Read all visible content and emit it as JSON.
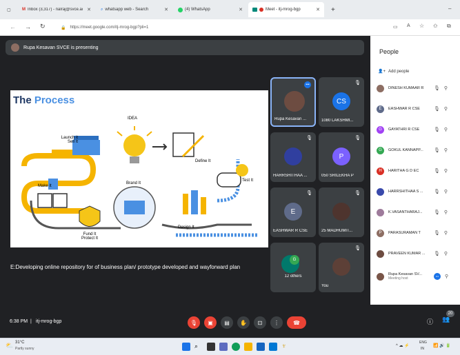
{
  "browser": {
    "tabs": [
      {
        "label": "Inbox (3,317) - nalraj@svce.ac.in",
        "icon": "gmail-icon"
      },
      {
        "label": "whatsapp web - Search",
        "icon": "search-icon"
      },
      {
        "label": "(4) WhatsApp",
        "icon": "whatsapp-icon"
      },
      {
        "label": "Meet - itj-mrog-bgp",
        "icon": "meet-icon"
      }
    ],
    "url": "https://meet.google.com/itj-mrog-bgp?pli=1"
  },
  "meet": {
    "presenting_banner": "Rupa Kesavan SVCE is presenting",
    "slide": {
      "title_part1": "The",
      "title_part2": "Process",
      "labels": [
        "IDEA",
        "Launch it\nSell It",
        "Define It",
        "Make It",
        "Brand It",
        "Test It",
        "Design It",
        "Fund It\nProtect It"
      ]
    },
    "caption": "E:Developing online repository for of business plan/ prototype developed and wayforward plan",
    "tiles": [
      {
        "name": "Rupa Kesavan ...",
        "initials": "",
        "color": "#5f6368"
      },
      {
        "name": "1080 LAKSHMI...",
        "initials": "CS",
        "color": "#1a73e8"
      },
      {
        "name": "HARRSHITHAA ...",
        "initials": "",
        "color": "#5f6368"
      },
      {
        "name": "050 SRILEKHA P",
        "initials": "P",
        "color": "#7b61ff"
      },
      {
        "name": "EASHWAR R CSE",
        "initials": "E",
        "color": "#5f6368"
      },
      {
        "name": "25 MADHUMIT...",
        "initials": "",
        "color": "#5f6368"
      },
      {
        "name": "12 others",
        "initials": "",
        "color": "#5f6368"
      },
      {
        "name": "You",
        "initials": "",
        "color": "#5f6368"
      }
    ],
    "time": "6:38 PM",
    "meeting_code": "itj-mrog-bgp",
    "participant_count": "20"
  },
  "people": {
    "title": "People",
    "add_label": "Add people",
    "list": [
      {
        "name": "DINESH KUMAAR R",
        "initial": "",
        "color": "#8d6e63"
      },
      {
        "name": "EASHWAR R CSE",
        "initial": "E",
        "color": "#5f6b8a"
      },
      {
        "name": "GAYATHRI R CSE",
        "initial": "G",
        "color": "#a142f4"
      },
      {
        "name": "GOKUL KANNAPP...",
        "initial": "G",
        "color": "#34a853"
      },
      {
        "name": "HARITHA G D EC",
        "initial": "H",
        "color": "#d93025"
      },
      {
        "name": "HARRSHITHAA S ...",
        "initial": "",
        "color": "#3949ab"
      },
      {
        "name": "K.VASANTHARAJ...",
        "initial": "",
        "color": "#9e7b9b"
      },
      {
        "name": "PARASURAMAN T",
        "initial": "P",
        "color": "#8d6e63"
      },
      {
        "name": "PRAVEEN KUMAR ...",
        "initial": "",
        "color": "#6d4c41"
      },
      {
        "name": "Rupa Kesavan SV...",
        "initial": "",
        "color": "#795548",
        "sub": "Meeting host"
      }
    ]
  },
  "taskbar": {
    "weather_temp": "31°C",
    "weather_text": "Partly sunny",
    "lang": "ENG",
    "region": "IN"
  }
}
